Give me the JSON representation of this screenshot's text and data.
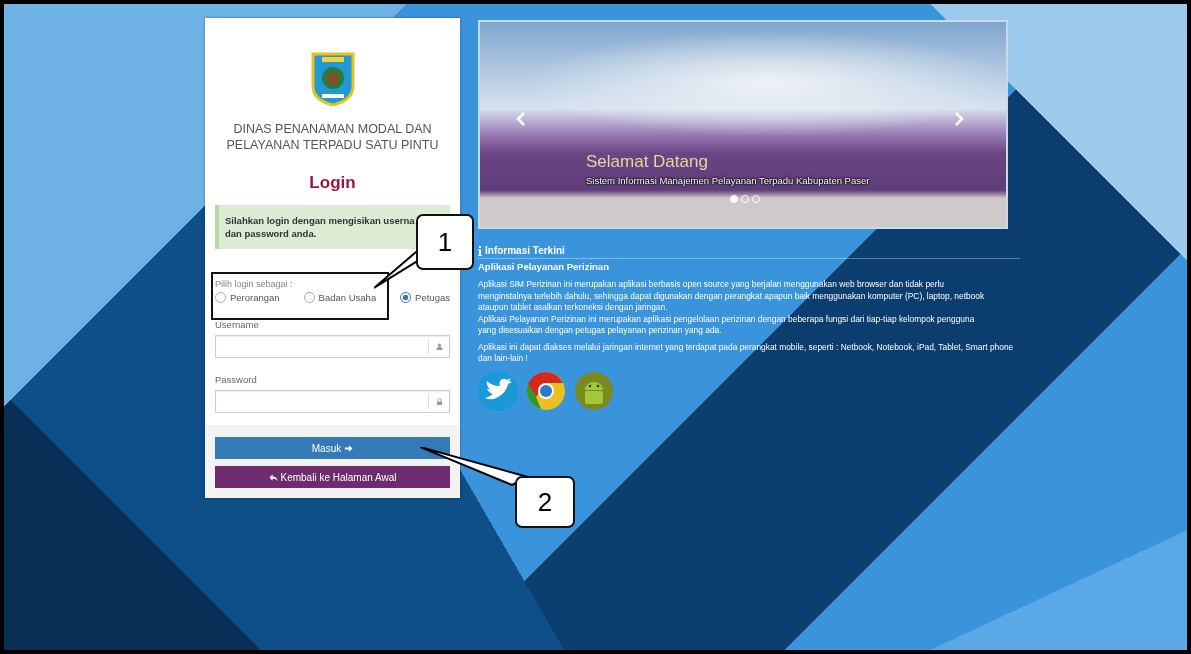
{
  "login_panel": {
    "agency_name": [
      "DINAS PENANAMAN MODAL DAN",
      "PELAYANAN TERPADU SATU PINTU"
    ],
    "title": "Login",
    "alert": [
      "Silahkan login dengan mengisikan userna",
      "dan password anda."
    ],
    "role_label": "Pilih login sebagai :",
    "roles": [
      {
        "label": "Perorangan",
        "selected": false
      },
      {
        "label": "Badan Usaha",
        "selected": false
      },
      {
        "label": "Petugas",
        "selected": true
      }
    ],
    "fields": [
      {
        "label": "Username",
        "kind": "user"
      },
      {
        "label": "Password",
        "kind": "lock"
      }
    ],
    "buttons": [
      {
        "label": "Masuk",
        "kind": "primary"
      },
      {
        "label": "Kembali ke Halaman Awal",
        "kind": "back"
      }
    ]
  },
  "carousel": {
    "caption_title": "Selamat Datang",
    "caption_text": "Sistem Informasi Manajemen Pelayanan Terpadu Kabupaten Paser",
    "indicators": [
      {
        "selected": true
      },
      {
        "selected": false
      },
      {
        "selected": false
      }
    ]
  },
  "info": {
    "heading": "Informasi Terkini",
    "subheading": "Aplikasi Pelayanan Perizinan",
    "paragraphs": [
      "Aplikasi SIM Perizinan ini merupakan aplikasi berbasis open source yang berjalan menggunakan web browser dan tidak perlu menginstalnya terlebih dahulu, sehingga dapat digunakan dengan perangkat apapun baik menggunakan komputer (PC), laptop, netbook ataupun tablet asalkan terkoneksi dengan jaringan.",
      "Aplikasi Pelayanan Perizinan ini merupakan aplikasi pengelolaan perizinan dengan beberapa fungsi dari tiap-tiap kelompok pengguna yang disesuaikan dengan petugas pelayanan perizinan yang ada.",
      "Aplikasi ini dapat diakses melalui jaringan internet yang terdapat pada perangkat mobile, seperti : Netbook, Notebook, iPad, Tablet, Smart phone dan lain-lain !"
    ]
  },
  "callouts": [
    {
      "number": "1"
    },
    {
      "number": "2"
    }
  ]
}
